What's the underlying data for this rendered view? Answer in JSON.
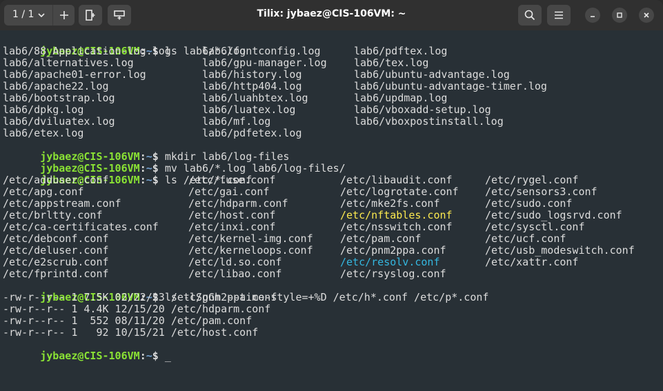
{
  "window": {
    "title": "Tilix: jybaez@CIS-106VM: ~",
    "session_label": "1 / 1"
  },
  "colors": {
    "prompt_user": "#8ae234",
    "prompt_path": "#729fcf",
    "highlight_yellow": "#fce94f",
    "highlight_cyan": "#34b7e0",
    "terminal_bg": "#283036",
    "terminal_fg": "#dcdcdc",
    "titlebar_bg": "#303030"
  },
  "icons": {
    "session_dropdown": "chevron-down-icon",
    "add_session": "plus-icon",
    "split_right": "split-right-icon",
    "split_down": "split-down-icon",
    "search": "search-icon",
    "menu": "hamburger-menu-icon",
    "minimize": "minimize-icon",
    "maximize": "maximize-icon",
    "close": "close-icon"
  },
  "terminal": {
    "prompt_user": "jybaez@CIS-106VM",
    "prompt_sep": ":",
    "prompt_path": "~",
    "prompt_symbol": "$",
    "commands": [
      "ls lab6/*.log",
      "mkdir lab6/log-files",
      "mv lab6/*.log lab6/log-files/",
      "ls /etc/*.conf",
      "ls -lSgGh --time-style=+%D /etc/h*.conf /etc/p*.conf",
      "_"
    ],
    "log_listing": [
      [
        "lab6/88_Application-log.log",
        "lab6/fontconfig.log",
        "lab6/pdftex.log"
      ],
      [
        "lab6/alternatives.log",
        "lab6/gpu-manager.log",
        "lab6/tex.log"
      ],
      [
        "lab6/apache01-error.log",
        "lab6/history.log",
        "lab6/ubuntu-advantage.log"
      ],
      [
        "lab6/apache22.log",
        "lab6/http404.log",
        "lab6/ubuntu-advantage-timer.log"
      ],
      [
        "lab6/bootstrap.log",
        "lab6/luahbtex.log",
        "lab6/updmap.log"
      ],
      [
        "lab6/dpkg.log",
        "lab6/luatex.log",
        "lab6/vboxadd-setup.log"
      ],
      [
        "lab6/dviluatex.log",
        "lab6/mf.log",
        "lab6/vboxpostinstall.log"
      ],
      [
        "lab6/etex.log",
        "lab6/pdfetex.log",
        ""
      ]
    ],
    "conf_listing": [
      [
        "/etc/adduser.conf",
        "/etc/fuse.conf",
        "/etc/libaudit.conf",
        "/etc/rygel.conf"
      ],
      [
        "/etc/apg.conf",
        "/etc/gai.conf",
        "/etc/logrotate.conf",
        "/etc/sensors3.conf"
      ],
      [
        "/etc/appstream.conf",
        "/etc/hdparm.conf",
        "/etc/mke2fs.conf",
        "/etc/sudo.conf"
      ],
      [
        "/etc/brltty.conf",
        "/etc/host.conf",
        "/etc/nftables.conf",
        "/etc/sudo_logsrvd.conf"
      ],
      [
        "/etc/ca-certificates.conf",
        "/etc/inxi.conf",
        "/etc/nsswitch.conf",
        "/etc/sysctl.conf"
      ],
      [
        "/etc/debconf.conf",
        "/etc/kernel-img.conf",
        "/etc/pam.conf",
        "/etc/ucf.conf"
      ],
      [
        "/etc/deluser.conf",
        "/etc/kerneloops.conf",
        "/etc/pnm2ppa.conf",
        "/etc/usb_modeswitch.conf"
      ],
      [
        "/etc/e2scrub.conf",
        "/etc/ld.so.conf",
        "/etc/resolv.conf",
        "/etc/xattr.conf"
      ],
      [
        "/etc/fprintd.conf",
        "/etc/libao.conf",
        "/etc/rsyslog.conf",
        ""
      ]
    ],
    "conf_highlights": {
      "yellow": "/etc/nftables.conf",
      "cyan": "/etc/resolv.conf"
    },
    "long_listing": [
      "-rw-r--r-- 1 7.5K 02/22/23 /etc/pnm2ppa.conf",
      "-rw-r--r-- 1 4.4K 12/15/20 /etc/hdparm.conf",
      "-rw-r--r-- 1  552 08/11/20 /etc/pam.conf",
      "-rw-r--r-- 1   92 10/15/21 /etc/host.conf"
    ]
  }
}
